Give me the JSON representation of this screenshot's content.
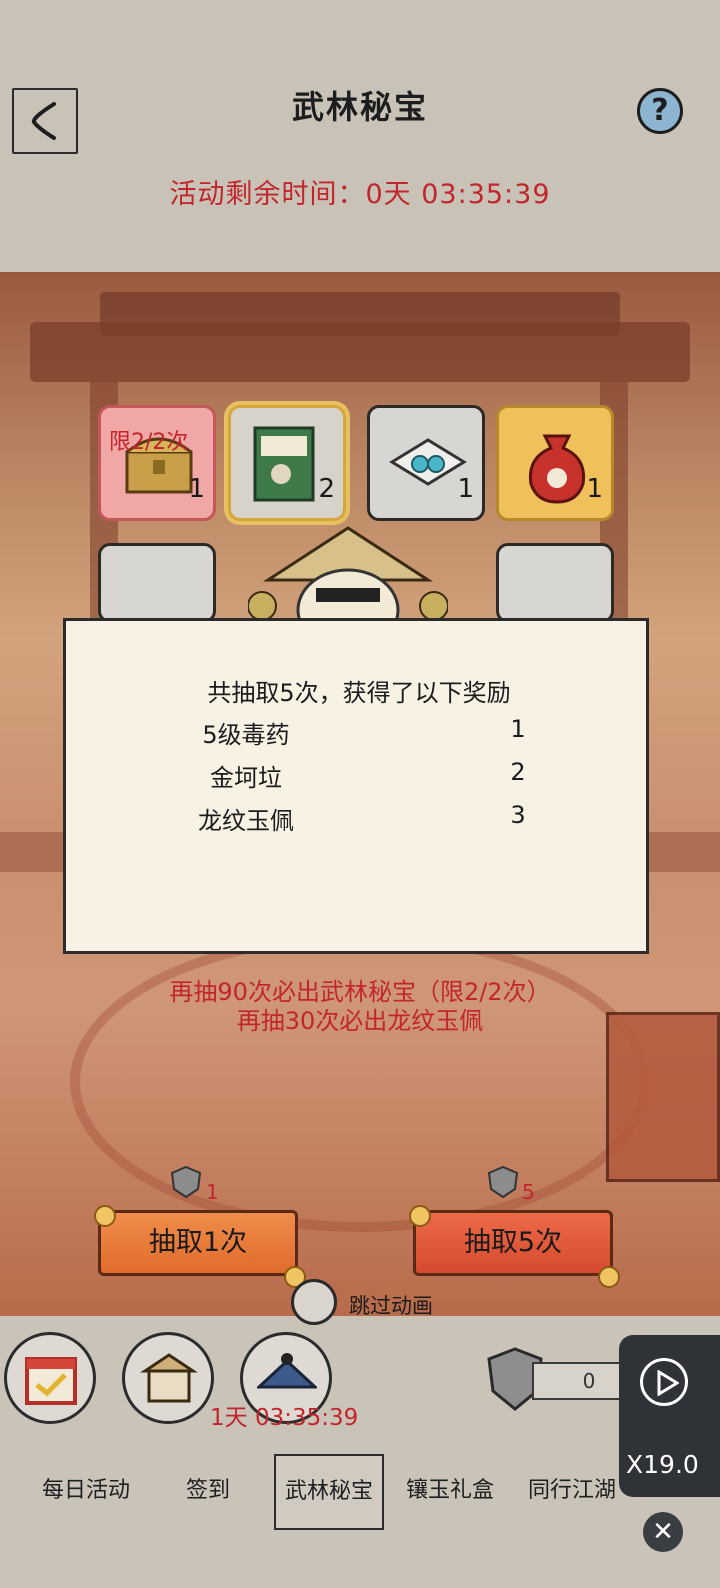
{
  "header": {
    "title": "武林秘宝",
    "help_label": "?",
    "timer": "活动剩余时间：0天 03:35:39"
  },
  "prize_grid": [
    {
      "name": "treasure-chest",
      "count": "1",
      "limit": "限2/2次"
    },
    {
      "name": "jin-ke-la",
      "count": "2"
    },
    {
      "name": "jade-orbs",
      "count": "1"
    },
    {
      "name": "money-bag",
      "count": "1"
    }
  ],
  "dialog": {
    "title": "共抽取5次，获得了以下奖励",
    "rewards": [
      {
        "name": "5级毒药",
        "count": "1"
      },
      {
        "name": "金坷垃",
        "count": "2"
      },
      {
        "name": "龙纹玉佩",
        "count": "3"
      }
    ]
  },
  "pity": {
    "line1": "再抽90次必出武林秘宝（限2/2次）",
    "line2": "再抽30次必出龙纹玉佩"
  },
  "draw": {
    "single": {
      "label": "抽取1次",
      "cost": "1"
    },
    "five": {
      "label": "抽取5次",
      "cost": "5"
    }
  },
  "skip_animation": "跳过动画",
  "bottom": {
    "countdown": "1天 03:35:39",
    "resource_value": "0",
    "tabs": [
      "每日活动",
      "签到",
      "武林秘宝",
      "镶玉礼盒",
      "同行江湖"
    ]
  },
  "overlay": {
    "speed": "X19.0",
    "close": "✕"
  },
  "colors": {
    "accent_red": "#c2262c",
    "button_orange": "#e06b2c",
    "paper": "#f8f2e5"
  }
}
